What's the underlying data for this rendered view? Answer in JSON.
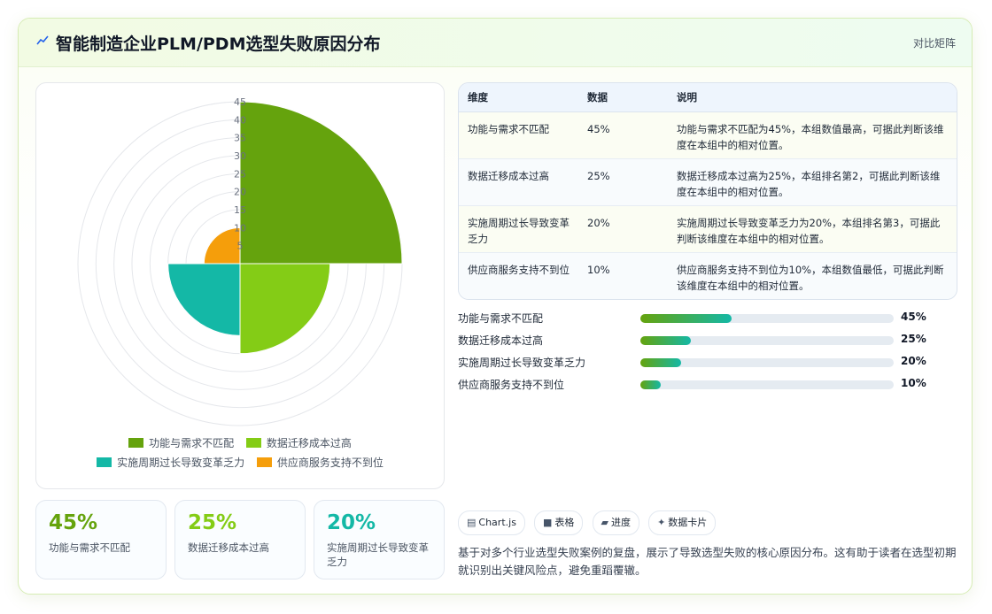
{
  "header": {
    "title": "智能制造企业PLM/PDM选型失败原因分布",
    "view_link": "对比矩阵"
  },
  "chart_data": {
    "type": "polarArea",
    "categories": [
      "功能与需求不匹配",
      "数据迁移成本过高",
      "实施周期过长导致变革乏力",
      "供应商服务支持不到位"
    ],
    "values": [
      45,
      25,
      20,
      10
    ],
    "colors": [
      "#65a30d",
      "#84cc16",
      "#14b8a6",
      "#f59e0b"
    ],
    "r_max": 45,
    "r_ticks": [
      5,
      10,
      15,
      20,
      25,
      30,
      35,
      40,
      45
    ],
    "legend_position": "bottom"
  },
  "table": {
    "headers": [
      "维度",
      "数据",
      "说明"
    ],
    "rows": [
      [
        "功能与需求不匹配",
        "45%",
        "功能与需求不匹配为45%，本组数值最高，可据此判断该维度在本组中的相对位置。"
      ],
      [
        "数据迁移成本过高",
        "25%",
        "数据迁移成本过高为25%，本组排名第2，可据此判断该维度在本组中的相对位置。"
      ],
      [
        "实施周期过长导致变革乏力",
        "20%",
        "实施周期过长导致变革乏力为20%，本组排名第3，可据此判断该维度在本组中的相对位置。"
      ],
      [
        "供应商服务支持不到位",
        "10%",
        "供应商服务支持不到位为10%，本组数值最低，可据此判断该维度在本组中的相对位置。"
      ]
    ]
  },
  "progress": [
    {
      "label": "功能与需求不匹配",
      "value": 45,
      "pct_label": "45%"
    },
    {
      "label": "数据迁移成本过高",
      "value": 25,
      "pct_label": "25%"
    },
    {
      "label": "实施周期过长导致变革乏力",
      "value": 20,
      "pct_label": "20%"
    },
    {
      "label": "供应商服务支持不到位",
      "value": 10,
      "pct_label": "10%"
    }
  ],
  "stats": [
    {
      "value": "45%",
      "label": "功能与需求不匹配",
      "color": "#65a30d"
    },
    {
      "value": "25%",
      "label": "数据迁移成本过高",
      "color": "#84cc16"
    },
    {
      "value": "20%",
      "label": "实施周期过长导致变革乏力",
      "color": "#14b8a6"
    }
  ],
  "tags": [
    {
      "icon": "chart-icon",
      "glyph": "▤",
      "label": "Chart.js"
    },
    {
      "icon": "table-icon",
      "glyph": "■",
      "label": "表格"
    },
    {
      "icon": "progress-icon",
      "glyph": "▰",
      "label": "进度"
    },
    {
      "icon": "sparkle-icon",
      "glyph": "✦",
      "label": "数据卡片"
    }
  ],
  "description": "基于对多个行业选型失败案例的复盘，展示了导致选型失败的核心原因分布。这有助于读者在选型初期就识别出关键风险点，避免重蹈覆辙。"
}
